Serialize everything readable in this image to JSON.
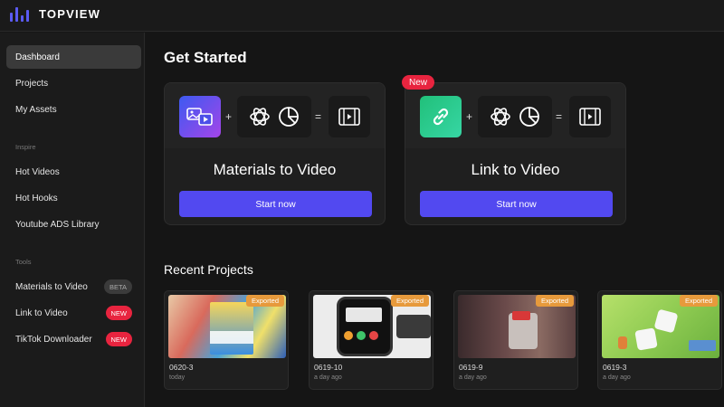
{
  "brand": {
    "name": "TOPVIEW"
  },
  "sidebar": {
    "items": [
      {
        "label": "Dashboard",
        "active": true
      },
      {
        "label": "Projects"
      },
      {
        "label": "My Assets"
      }
    ],
    "inspire_label": "Inspire",
    "inspire_items": [
      {
        "label": "Hot Videos"
      },
      {
        "label": "Hot Hooks"
      },
      {
        "label": "Youtube ADS Library"
      }
    ],
    "tools_label": "Tools",
    "tools_items": [
      {
        "label": "Materials to Video",
        "badge": "BETA"
      },
      {
        "label": "Link to Video",
        "badge": "NEW"
      },
      {
        "label": "TikTok Downloader",
        "badge": "NEW"
      }
    ]
  },
  "main": {
    "title": "Get Started",
    "cards": [
      {
        "title": "Materials to Video",
        "button": "Start now",
        "icon": "images-video-icon",
        "plus": "+",
        "equals": "="
      },
      {
        "title": "Link to Video",
        "button": "Start now",
        "icon": "link-icon",
        "tag": "New",
        "plus": "+",
        "equals": "="
      }
    ],
    "recent_title": "Recent Projects",
    "projects": [
      {
        "name": "0620-3",
        "date": "today",
        "status": "Exported"
      },
      {
        "name": "0619-10",
        "date": "a day ago",
        "status": "Exported"
      },
      {
        "name": "0619-9",
        "date": "a day ago",
        "status": "Exported"
      },
      {
        "name": "0619-3",
        "date": "a day ago",
        "status": "Exported"
      }
    ]
  },
  "colors": {
    "accent": "#5249f0",
    "badge_new": "#e8243f",
    "exported": "#e79a3c"
  }
}
